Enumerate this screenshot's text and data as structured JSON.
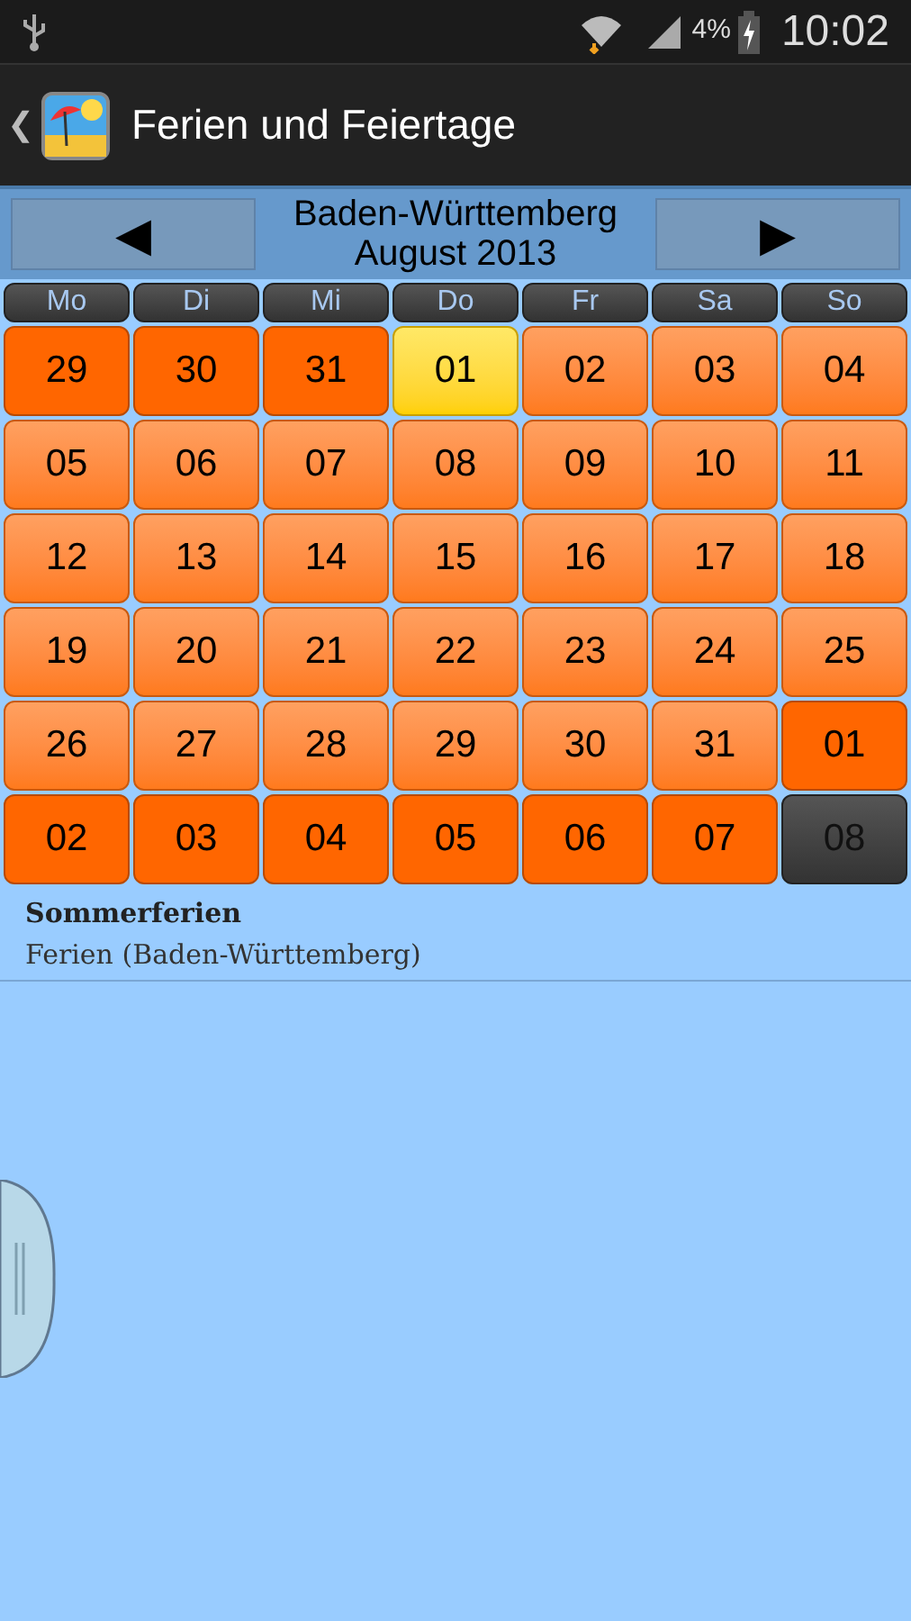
{
  "status_bar": {
    "battery": "4%",
    "time": "10:02"
  },
  "action_bar": {
    "back": "❮",
    "title": "Ferien und Feiertage"
  },
  "header": {
    "prev": "◀",
    "region": "Baden-Württemberg",
    "month": "August 2013",
    "next": "▶"
  },
  "weekdays": [
    "Mo",
    "Di",
    "Mi",
    "Do",
    "Fr",
    "Sa",
    "So"
  ],
  "days": [
    {
      "label": "29",
      "kind": "other"
    },
    {
      "label": "30",
      "kind": "other"
    },
    {
      "label": "31",
      "kind": "other"
    },
    {
      "label": "01",
      "kind": "today"
    },
    {
      "label": "02",
      "kind": "month"
    },
    {
      "label": "03",
      "kind": "month"
    },
    {
      "label": "04",
      "kind": "month"
    },
    {
      "label": "05",
      "kind": "month"
    },
    {
      "label": "06",
      "kind": "month"
    },
    {
      "label": "07",
      "kind": "month"
    },
    {
      "label": "08",
      "kind": "month"
    },
    {
      "label": "09",
      "kind": "month"
    },
    {
      "label": "10",
      "kind": "month"
    },
    {
      "label": "11",
      "kind": "month"
    },
    {
      "label": "12",
      "kind": "month"
    },
    {
      "label": "13",
      "kind": "month"
    },
    {
      "label": "14",
      "kind": "month"
    },
    {
      "label": "15",
      "kind": "month"
    },
    {
      "label": "16",
      "kind": "month"
    },
    {
      "label": "17",
      "kind": "month"
    },
    {
      "label": "18",
      "kind": "month"
    },
    {
      "label": "19",
      "kind": "month"
    },
    {
      "label": "20",
      "kind": "month"
    },
    {
      "label": "21",
      "kind": "month"
    },
    {
      "label": "22",
      "kind": "month"
    },
    {
      "label": "23",
      "kind": "month"
    },
    {
      "label": "24",
      "kind": "month"
    },
    {
      "label": "25",
      "kind": "month"
    },
    {
      "label": "26",
      "kind": "month"
    },
    {
      "label": "27",
      "kind": "month"
    },
    {
      "label": "28",
      "kind": "month"
    },
    {
      "label": "29",
      "kind": "month"
    },
    {
      "label": "30",
      "kind": "month"
    },
    {
      "label": "31",
      "kind": "month"
    },
    {
      "label": "01",
      "kind": "other"
    },
    {
      "label": "02",
      "kind": "other"
    },
    {
      "label": "03",
      "kind": "other"
    },
    {
      "label": "04",
      "kind": "other"
    },
    {
      "label": "05",
      "kind": "other"
    },
    {
      "label": "06",
      "kind": "other"
    },
    {
      "label": "07",
      "kind": "other"
    },
    {
      "label": "08",
      "kind": "dark"
    }
  ],
  "events": [
    {
      "title": "Sommerferien",
      "subtitle": "Ferien (Baden-Württemberg)"
    }
  ]
}
